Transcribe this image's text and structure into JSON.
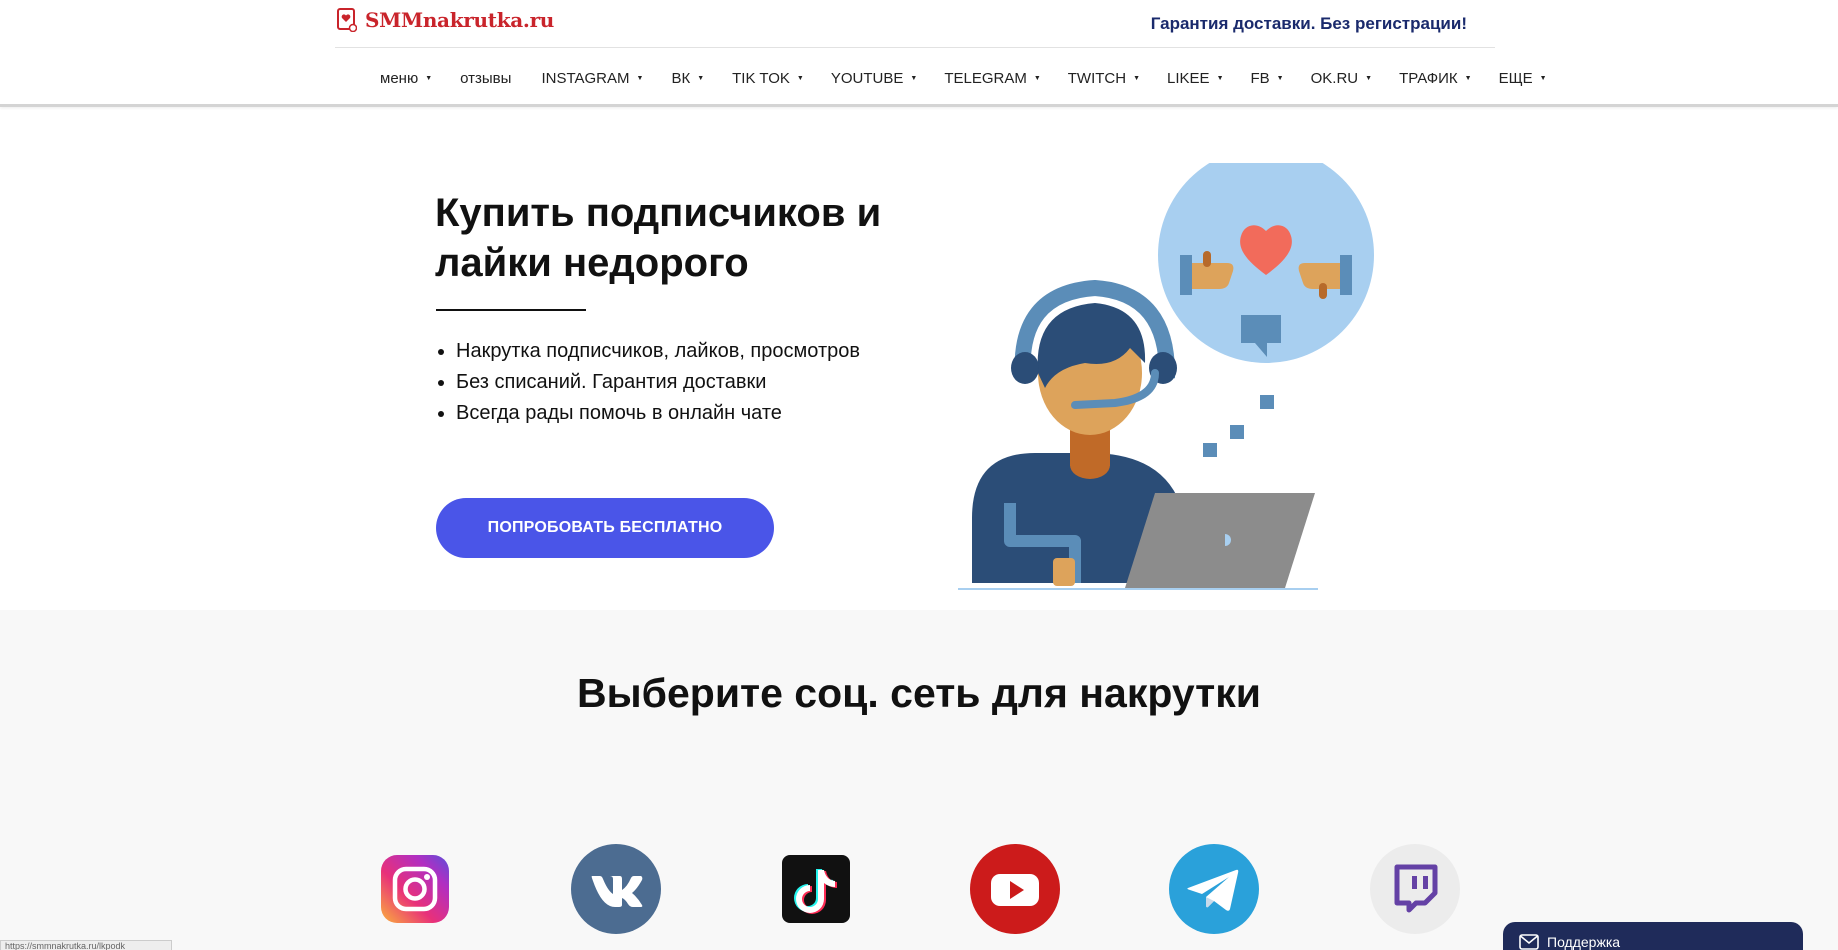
{
  "header": {
    "logo_text": "SMMnakrutka.ru",
    "guarantee": "Гарантия доставки. Без регистрации!"
  },
  "nav": [
    {
      "label": "меню",
      "dropdown": true
    },
    {
      "label": "отзывы",
      "dropdown": false
    },
    {
      "label": "INSTAGRAM",
      "dropdown": true
    },
    {
      "label": "ВК",
      "dropdown": true
    },
    {
      "label": "TIK TOK",
      "dropdown": true
    },
    {
      "label": "YOUTUBE",
      "dropdown": true
    },
    {
      "label": "TELEGRAM",
      "dropdown": true
    },
    {
      "label": "TWITCH",
      "dropdown": true
    },
    {
      "label": "LIKEE",
      "dropdown": true
    },
    {
      "label": "FB",
      "dropdown": true
    },
    {
      "label": "OK.RU",
      "dropdown": true
    },
    {
      "label": "ТРАФИК",
      "dropdown": true
    },
    {
      "label": "ЕЩЕ",
      "dropdown": true
    }
  ],
  "hero": {
    "title": "Купить подписчиков и лайки недорого",
    "bullets": [
      "Накрутка подписчиков, лайков, просмотров",
      "Без списаний. Гарантия доставки",
      "Всегда рады помочь в онлайн чате"
    ],
    "cta_label": "ПОПРОБОВАТЬ БЕСПЛАТНО"
  },
  "social": {
    "title": "Выберите соц. сеть для накрутки",
    "networks": [
      {
        "name": "instagram-icon"
      },
      {
        "name": "vk-icon"
      },
      {
        "name": "tiktok-icon"
      },
      {
        "name": "youtube-icon"
      },
      {
        "name": "telegram-icon"
      },
      {
        "name": "twitch-icon"
      }
    ]
  },
  "support": {
    "label": "Поддержка"
  },
  "status_bar": {
    "url": "https://smmnakrutka.ru/lkpodk"
  },
  "colors": {
    "brand_red": "#c9242b",
    "cta": "#4a55e8",
    "guarantee_text": "#1a2a6c",
    "support_bg": "#1f2b5a"
  }
}
